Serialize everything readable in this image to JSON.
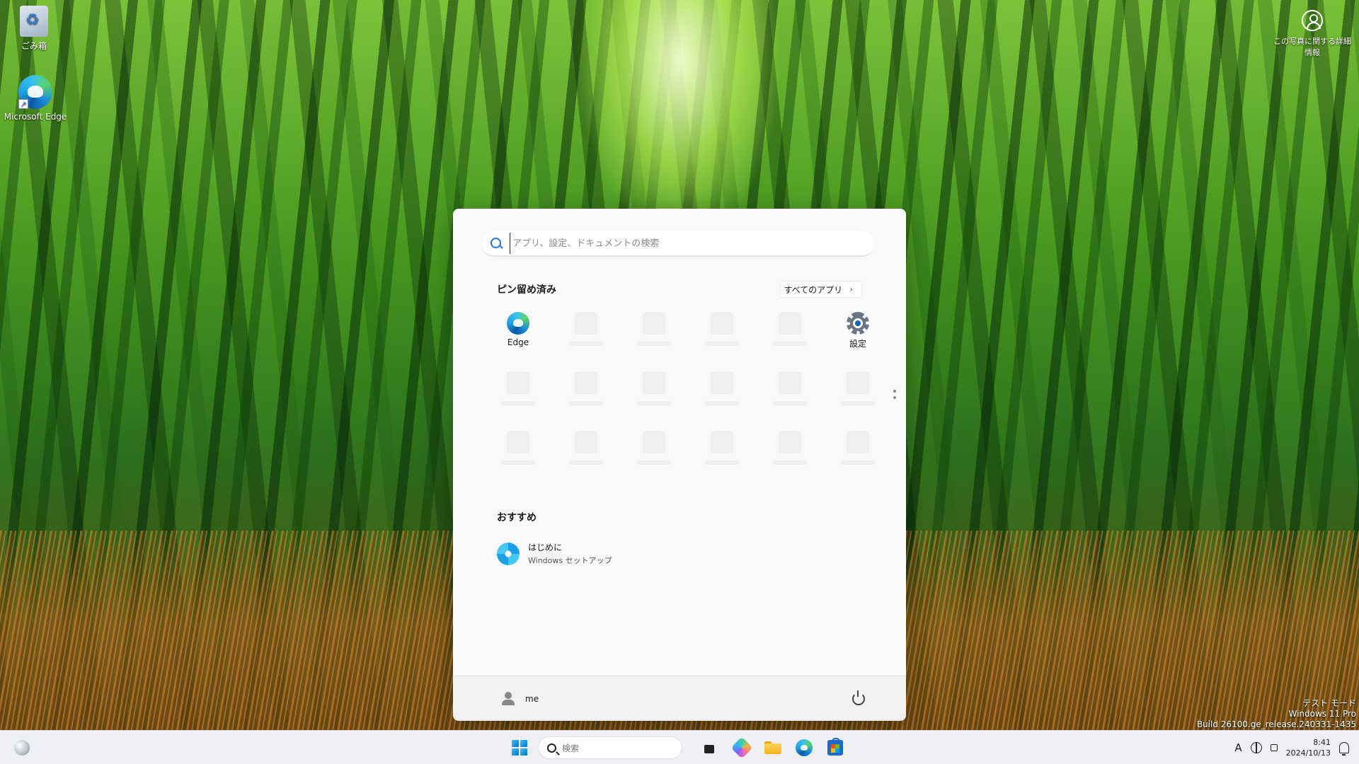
{
  "desktop": {
    "icons": [
      {
        "label": "ごみ箱",
        "icon": "recycle-bin-icon"
      },
      {
        "label": "Microsoft Edge",
        "icon": "edge-icon"
      }
    ],
    "photo_info": {
      "label": "この写真に関する詳細情報",
      "icon": "person-circle-icon"
    },
    "watermark": {
      "line1": "テスト モード",
      "line2": "Windows 11 Pro",
      "line3": "Build 26100.ge_release.240331-1435"
    }
  },
  "start_menu": {
    "search": {
      "placeholder": "アプリ、設定、ドキュメントの検索",
      "value": ""
    },
    "pinned": {
      "title": "ピン留め済み",
      "all_apps_label": "すべてのアプリ",
      "items": [
        {
          "label": "Edge",
          "icon": "edge-icon"
        },
        {
          "label": "",
          "icon": "placeholder"
        },
        {
          "label": "",
          "icon": "placeholder"
        },
        {
          "label": "",
          "icon": "placeholder"
        },
        {
          "label": "",
          "icon": "placeholder"
        },
        {
          "label": "設定",
          "icon": "gear-icon"
        }
      ]
    },
    "recommended": {
      "title": "おすすめ",
      "items": [
        {
          "name": "はじめに",
          "subtitle": "Windows セットアップ",
          "icon": "get-started-icon"
        }
      ]
    },
    "user": {
      "name": "me"
    }
  },
  "taskbar": {
    "search_placeholder": "検索",
    "tray": {
      "ime": "A",
      "time": "8:41",
      "date": "2024/10/13"
    }
  },
  "colors": {
    "accent": "#1b78d3",
    "start_bg": "#f9f9f9",
    "taskbar_bg": "#eef0f3"
  }
}
